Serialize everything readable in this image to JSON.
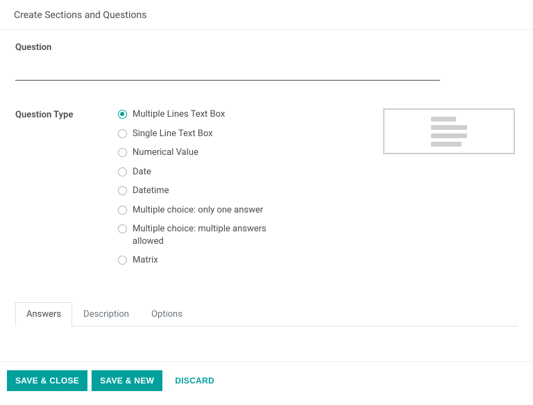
{
  "modal": {
    "title": "Create Sections and Questions"
  },
  "question": {
    "label": "Question",
    "value": ""
  },
  "questionType": {
    "label": "Question Type",
    "selected": 0,
    "options": [
      "Multiple Lines Text Box",
      "Single Line Text Box",
      "Numerical Value",
      "Date",
      "Datetime",
      "Multiple choice: only one answer",
      "Multiple choice: multiple answers allowed",
      "Matrix"
    ]
  },
  "tabs": {
    "active": 0,
    "items": [
      "Answers",
      "Description",
      "Options"
    ]
  },
  "footer": {
    "saveClose": "Save & Close",
    "saveNew": "Save & New",
    "discard": "Discard"
  }
}
